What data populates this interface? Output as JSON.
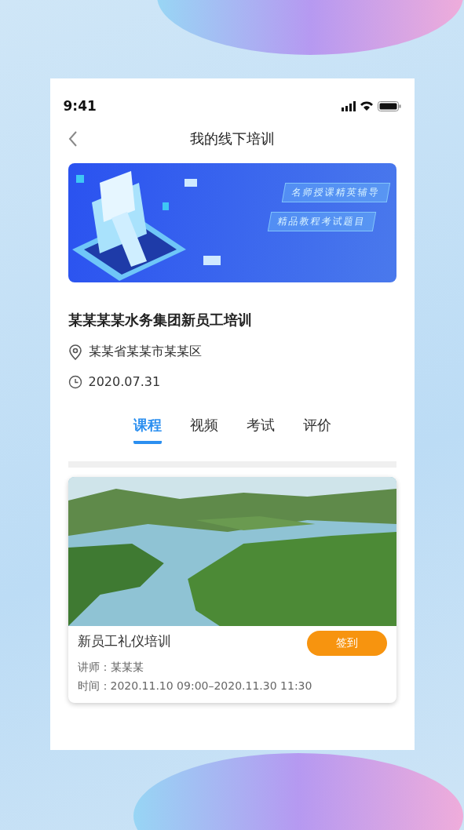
{
  "status_bar": {
    "time": "9:41"
  },
  "nav": {
    "title": "我的线下培训"
  },
  "banner": {
    "taglines": [
      "名师授课精英辅导",
      "精品教程考试题目"
    ]
  },
  "training": {
    "title": "某某某某水务集团新员工培训",
    "location": "某某省某某市某某区",
    "date": "2020.07.31"
  },
  "tabs": [
    {
      "label": "课程",
      "selected": true
    },
    {
      "label": "视频",
      "selected": false
    },
    {
      "label": "考试",
      "selected": false
    },
    {
      "label": "评价",
      "selected": false
    }
  ],
  "course": {
    "title": "新员工礼仪培训",
    "button": "签到",
    "teacher": "讲师：某某某",
    "time": "时间：2020.11.10 09:00–2020.11.30 11:30"
  }
}
